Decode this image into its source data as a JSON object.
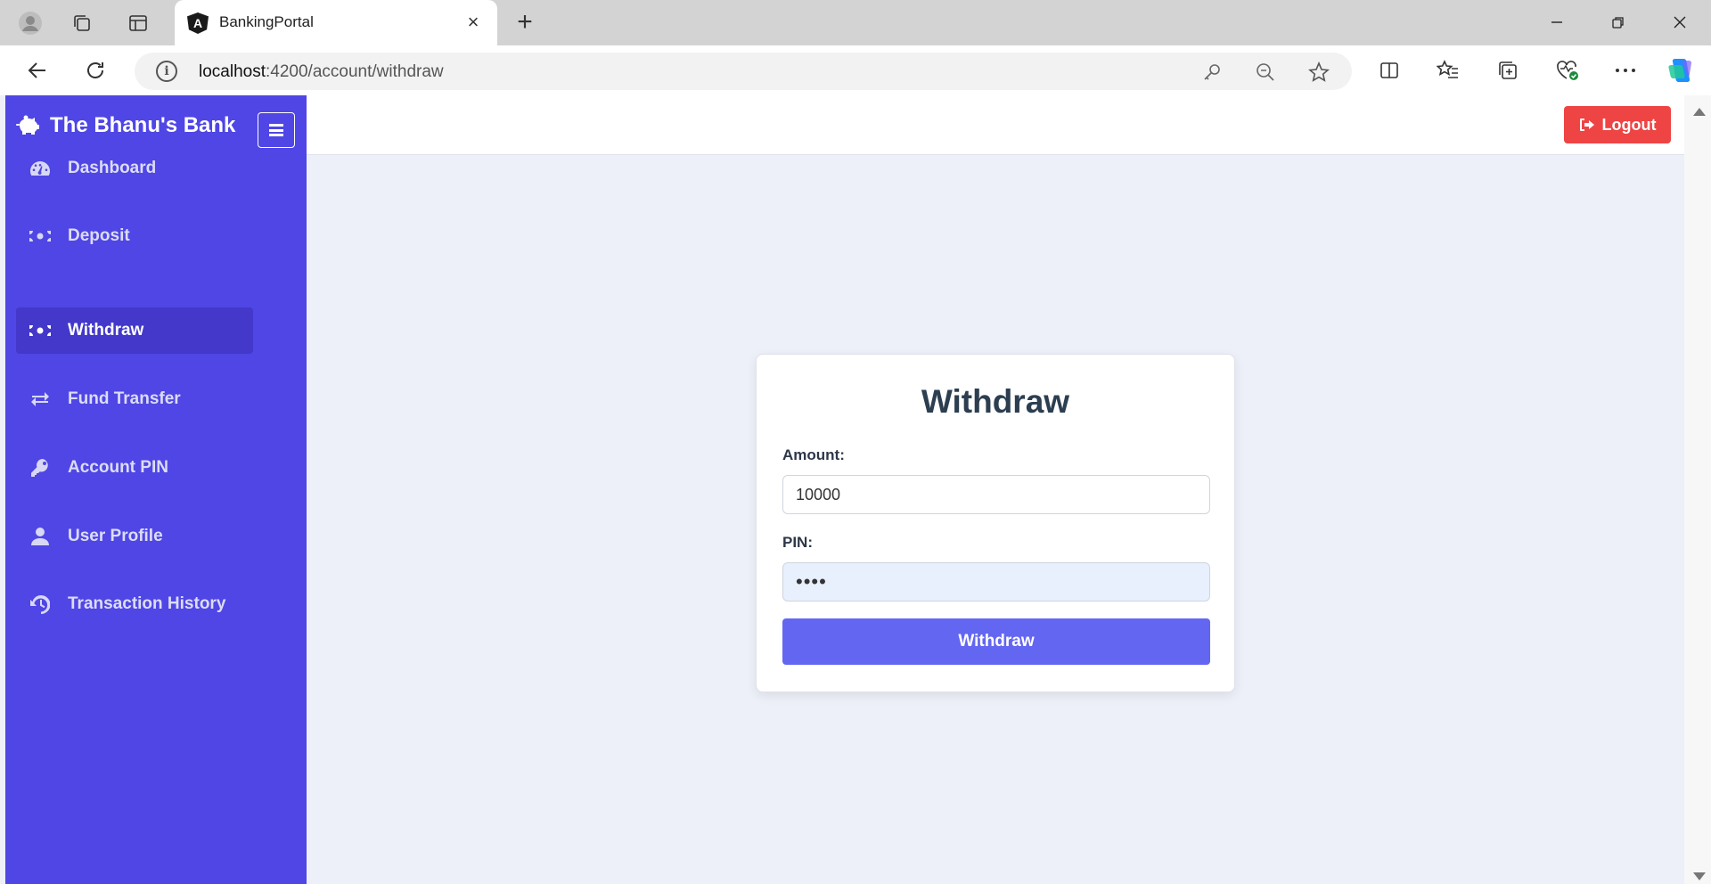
{
  "browser": {
    "tab_title": "BankingPortal",
    "url_host": "localhost",
    "url_path": ":4200/account/withdraw"
  },
  "app": {
    "brand": "The Bhanu's Bank",
    "sidebar": {
      "items": [
        {
          "label": "Dashboard",
          "icon": "dashboard-icon"
        },
        {
          "label": "Deposit",
          "icon": "money-icon"
        },
        {
          "label": "Withdraw",
          "icon": "money-icon",
          "active": true
        },
        {
          "label": "Fund Transfer",
          "icon": "transfer-icon"
        },
        {
          "label": "Account PIN",
          "icon": "key-icon"
        },
        {
          "label": "User Profile",
          "icon": "user-icon"
        },
        {
          "label": "Transaction History",
          "icon": "history-icon"
        }
      ]
    },
    "topbar": {
      "logout_label": "Logout"
    },
    "form": {
      "title": "Withdraw",
      "amount_label": "Amount:",
      "amount_value": "10000",
      "pin_label": "PIN:",
      "pin_value": "••••",
      "submit_label": "Withdraw"
    }
  },
  "colors": {
    "sidebar_bg": "#4f46e5",
    "sidebar_active": "#4338ca",
    "logout": "#ef4444",
    "submit": "#6366f1",
    "content_bg": "#edf0f8"
  }
}
